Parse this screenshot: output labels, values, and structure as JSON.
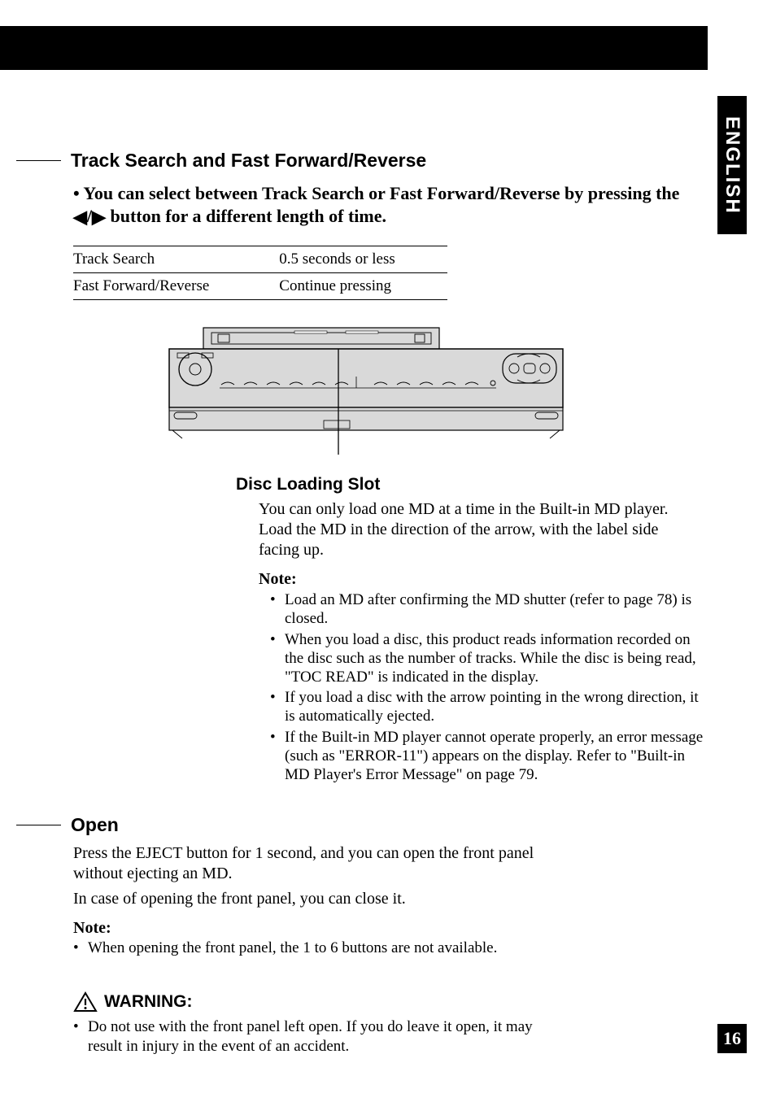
{
  "language_tab": "ENGLISH",
  "page_number": "16",
  "section1": {
    "title": "Track Search and Fast Forward/Reverse",
    "intro_prefix": "• You can select between Track Search or Fast Forward/Reverse by pressing the ",
    "intro_arrow_left": "◀",
    "intro_arrow_slash": "/",
    "intro_arrow_right": "▶",
    "intro_suffix": " button for a different length of time.",
    "table": [
      {
        "mode": "Track Search",
        "time": "0.5 seconds or less"
      },
      {
        "mode": "Fast Forward/Reverse",
        "time": "Continue pressing"
      }
    ],
    "disc_slot_title": "Disc Loading Slot",
    "disc_slot_body": "You can only load one MD at a time in the Built-in MD player. Load the MD in the direction of the arrow, with the label side facing up.",
    "note_label": "Note:",
    "notes": [
      "Load an MD after confirming the MD shutter (refer to page 78) is closed.",
      "When you load a disc, this product reads information recorded on the disc such as the number of tracks. While the disc is being read, \"TOC READ\" is indicated in the display.",
      "If you load a disc with the arrow pointing in the wrong direction, it is automatically ejected.",
      "If the Built-in MD player cannot operate properly, an error message (such as \"ERROR-11\") appears on the display. Refer to \"Built-in MD Player's Error Message\" on page 79."
    ]
  },
  "section2": {
    "title": "Open",
    "body1": "Press the EJECT button for 1 second, and you can open the front panel without ejecting an MD.",
    "body2": "In case of opening the front panel, you can close it.",
    "note_label": "Note:",
    "notes": [
      "When opening the front panel, the 1 to 6 buttons are not available."
    ],
    "warning_label": "WARNING:",
    "warning_items": [
      "Do not use with the front panel left open. If you do leave it open, it may result in injury in the event of an accident."
    ]
  }
}
